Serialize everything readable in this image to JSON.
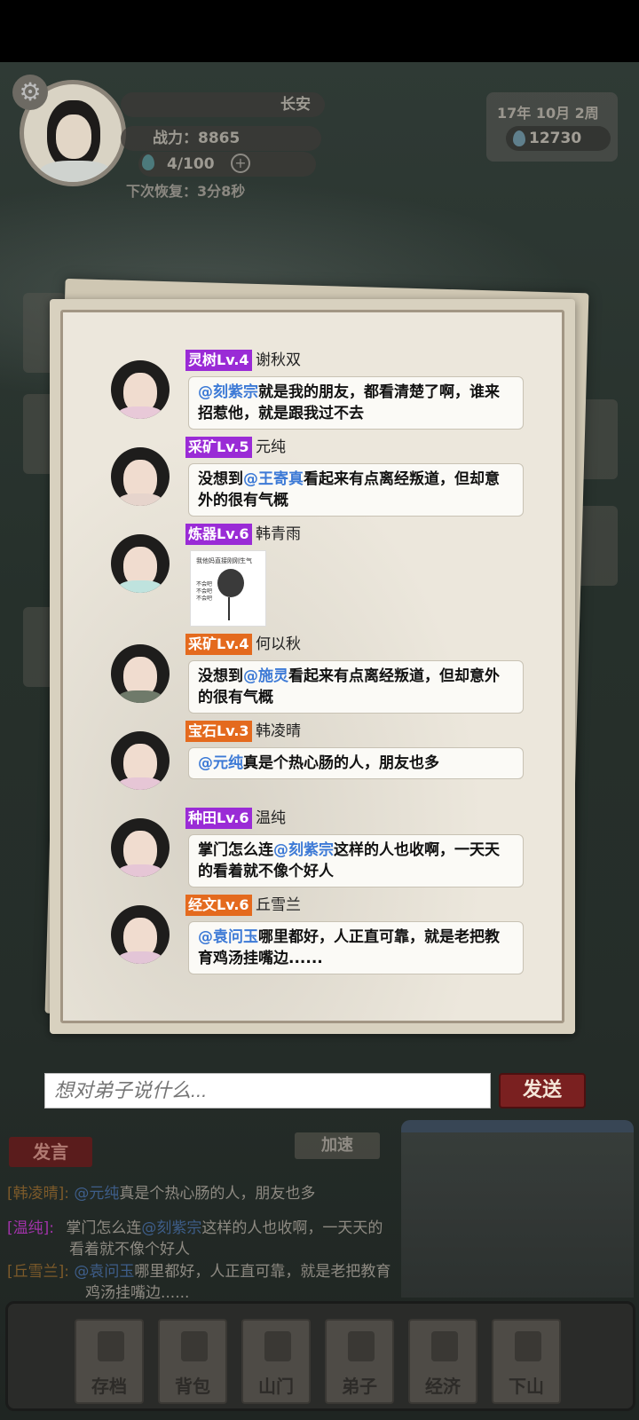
{
  "header": {
    "location": "长安",
    "combat_power": "战力：8865",
    "stamina": "4/100",
    "recover": "下次恢复：3分8秒",
    "date": "17年 10月  2周",
    "currency": "12730"
  },
  "chat": {
    "messages": [
      {
        "tag": "灵树Lv.4",
        "tag_color": "#9a2bd6",
        "name": "谢秋双",
        "mention": "@刻紫宗",
        "text": "就是我的朋友，都看清楚了啊，谁来招惹他，就是跟我过不去"
      },
      {
        "tag": "采矿Lv.5",
        "tag_color": "#9a2bd6",
        "name": "元纯",
        "pre": "没想到",
        "mention": "@王寄真",
        "text": "看起来有点离经叛道，但却意外的很有气概"
      },
      {
        "tag": "炼器Lv.6",
        "tag_color": "#9a2bd6",
        "name": "韩青雨",
        "sticker_caption": "我他妈直接刚刚生气",
        "sticker_side": "不会吧 不会吧 不会吧"
      },
      {
        "tag": "采矿Lv.4",
        "tag_color": "#e46a1e",
        "name": "何以秋",
        "pre": "没想到",
        "mention": "@施灵",
        "text": "看起来有点离经叛道，但却意外的很有气概"
      },
      {
        "tag": "宝石Lv.3",
        "tag_color": "#e46a1e",
        "name": "韩凌晴",
        "mention": "@元纯",
        "text": "真是个热心肠的人，朋友也多"
      },
      {
        "tag": "种田Lv.6",
        "tag_color": "#9a2bd6",
        "name": "温纯",
        "pre": "掌门怎么连",
        "mention": "@刻紫宗",
        "text": "这样的人也收啊，一天天的看着就不像个好人"
      },
      {
        "tag": "经文Lv.6",
        "tag_color": "#e46a1e",
        "name": "丘雪兰",
        "mention": "@袁问玉",
        "text": "哪里都好，人正直可靠，就是老把教育鸡汤挂嘴边......"
      }
    ],
    "input_placeholder": "想对弟子说什么...",
    "send_label": "发送"
  },
  "background": {
    "speak_label": "发言",
    "speed_label": "加速",
    "log": [
      {
        "name": "[韩凌晴]:",
        "mention": "@元纯",
        "text": "真是个热心肠的人，朋友也多"
      },
      {
        "name": "[温纯]:",
        "text": "掌门怎么连",
        "mention": "@刻紫宗",
        "text2": "这样的人也收啊，一天天的",
        "cont": "看着就不像个好人"
      },
      {
        "name": "[丘雪兰]:",
        "mention": "@袁问玉",
        "text": "哪里都好，人正直可靠，就是老把教育",
        "cont": "鸡汤挂嘴边......"
      }
    ]
  },
  "nav": [
    "存档",
    "背包",
    "山门",
    "弟子",
    "经济",
    "下山"
  ]
}
